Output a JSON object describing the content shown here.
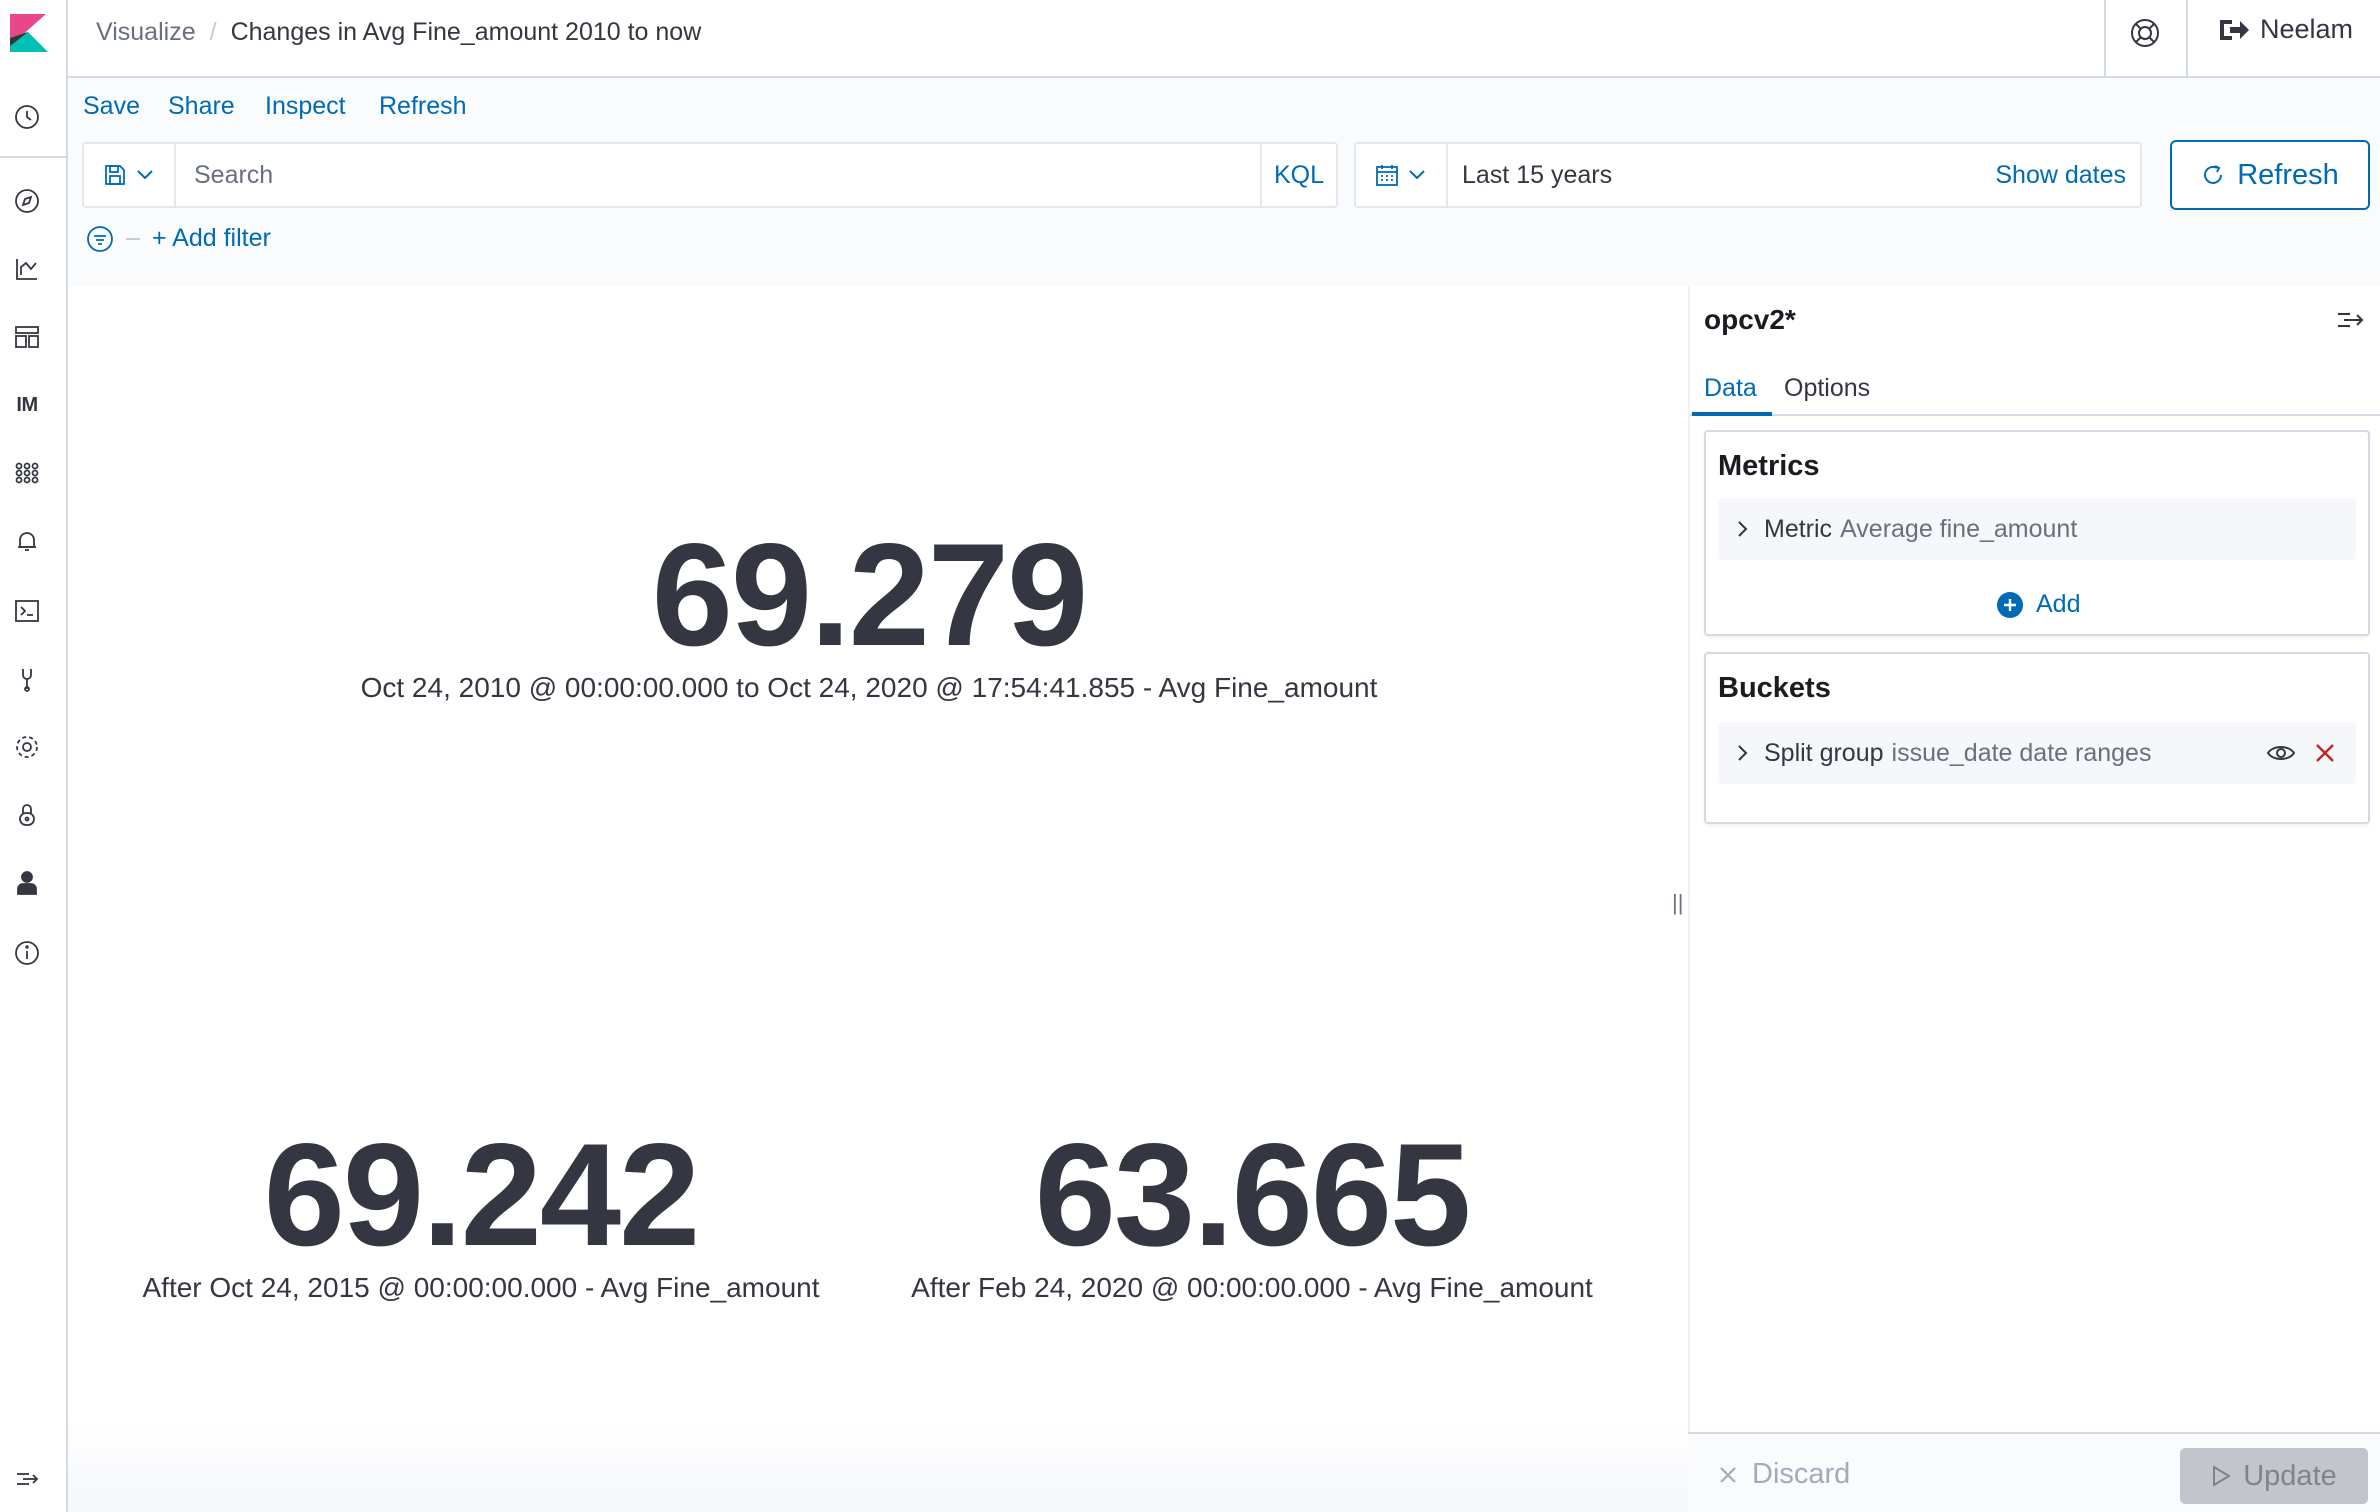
{
  "header": {
    "breadcrumb_parent": "Visualize",
    "breadcrumb_current": "Changes in Avg Fine_amount 2010 to now",
    "user_name": "Neelam"
  },
  "nav": {
    "im_label": "IM"
  },
  "topmenu": {
    "save": "Save",
    "share": "Share",
    "inspect": "Inspect",
    "refresh": "Refresh"
  },
  "query": {
    "search_placeholder": "Search",
    "language": "KQL",
    "time_range": "Last 15 years",
    "show_dates": "Show dates",
    "refresh_button": "Refresh",
    "add_filter": "+ Add filter"
  },
  "metrics": [
    {
      "value": "69.279",
      "label": "Oct 24, 2010 @ 00:00:00.000 to Oct 24, 2020 @ 17:54:41.855 - Avg Fine_amount"
    },
    {
      "value": "69.242",
      "label": "After Oct 24, 2015 @ 00:00:00.000 - Avg Fine_amount"
    },
    {
      "value": "63.665",
      "label": "After Feb 24, 2020 @ 00:00:00.000 - Avg Fine_amount"
    }
  ],
  "sidebar": {
    "index_pattern": "opcv2*",
    "tabs": [
      "Data",
      "Options"
    ],
    "metrics_title": "Metrics",
    "metric_row": {
      "type": "Metric",
      "desc": "Average fine_amount"
    },
    "add_label": "Add",
    "buckets_title": "Buckets",
    "bucket_row": {
      "type": "Split group",
      "desc": "issue_date date ranges"
    },
    "discard": "Discard",
    "update": "Update"
  },
  "colors": {
    "accent": "#006bb4",
    "text": "#343741",
    "danger": "#bd271e"
  }
}
